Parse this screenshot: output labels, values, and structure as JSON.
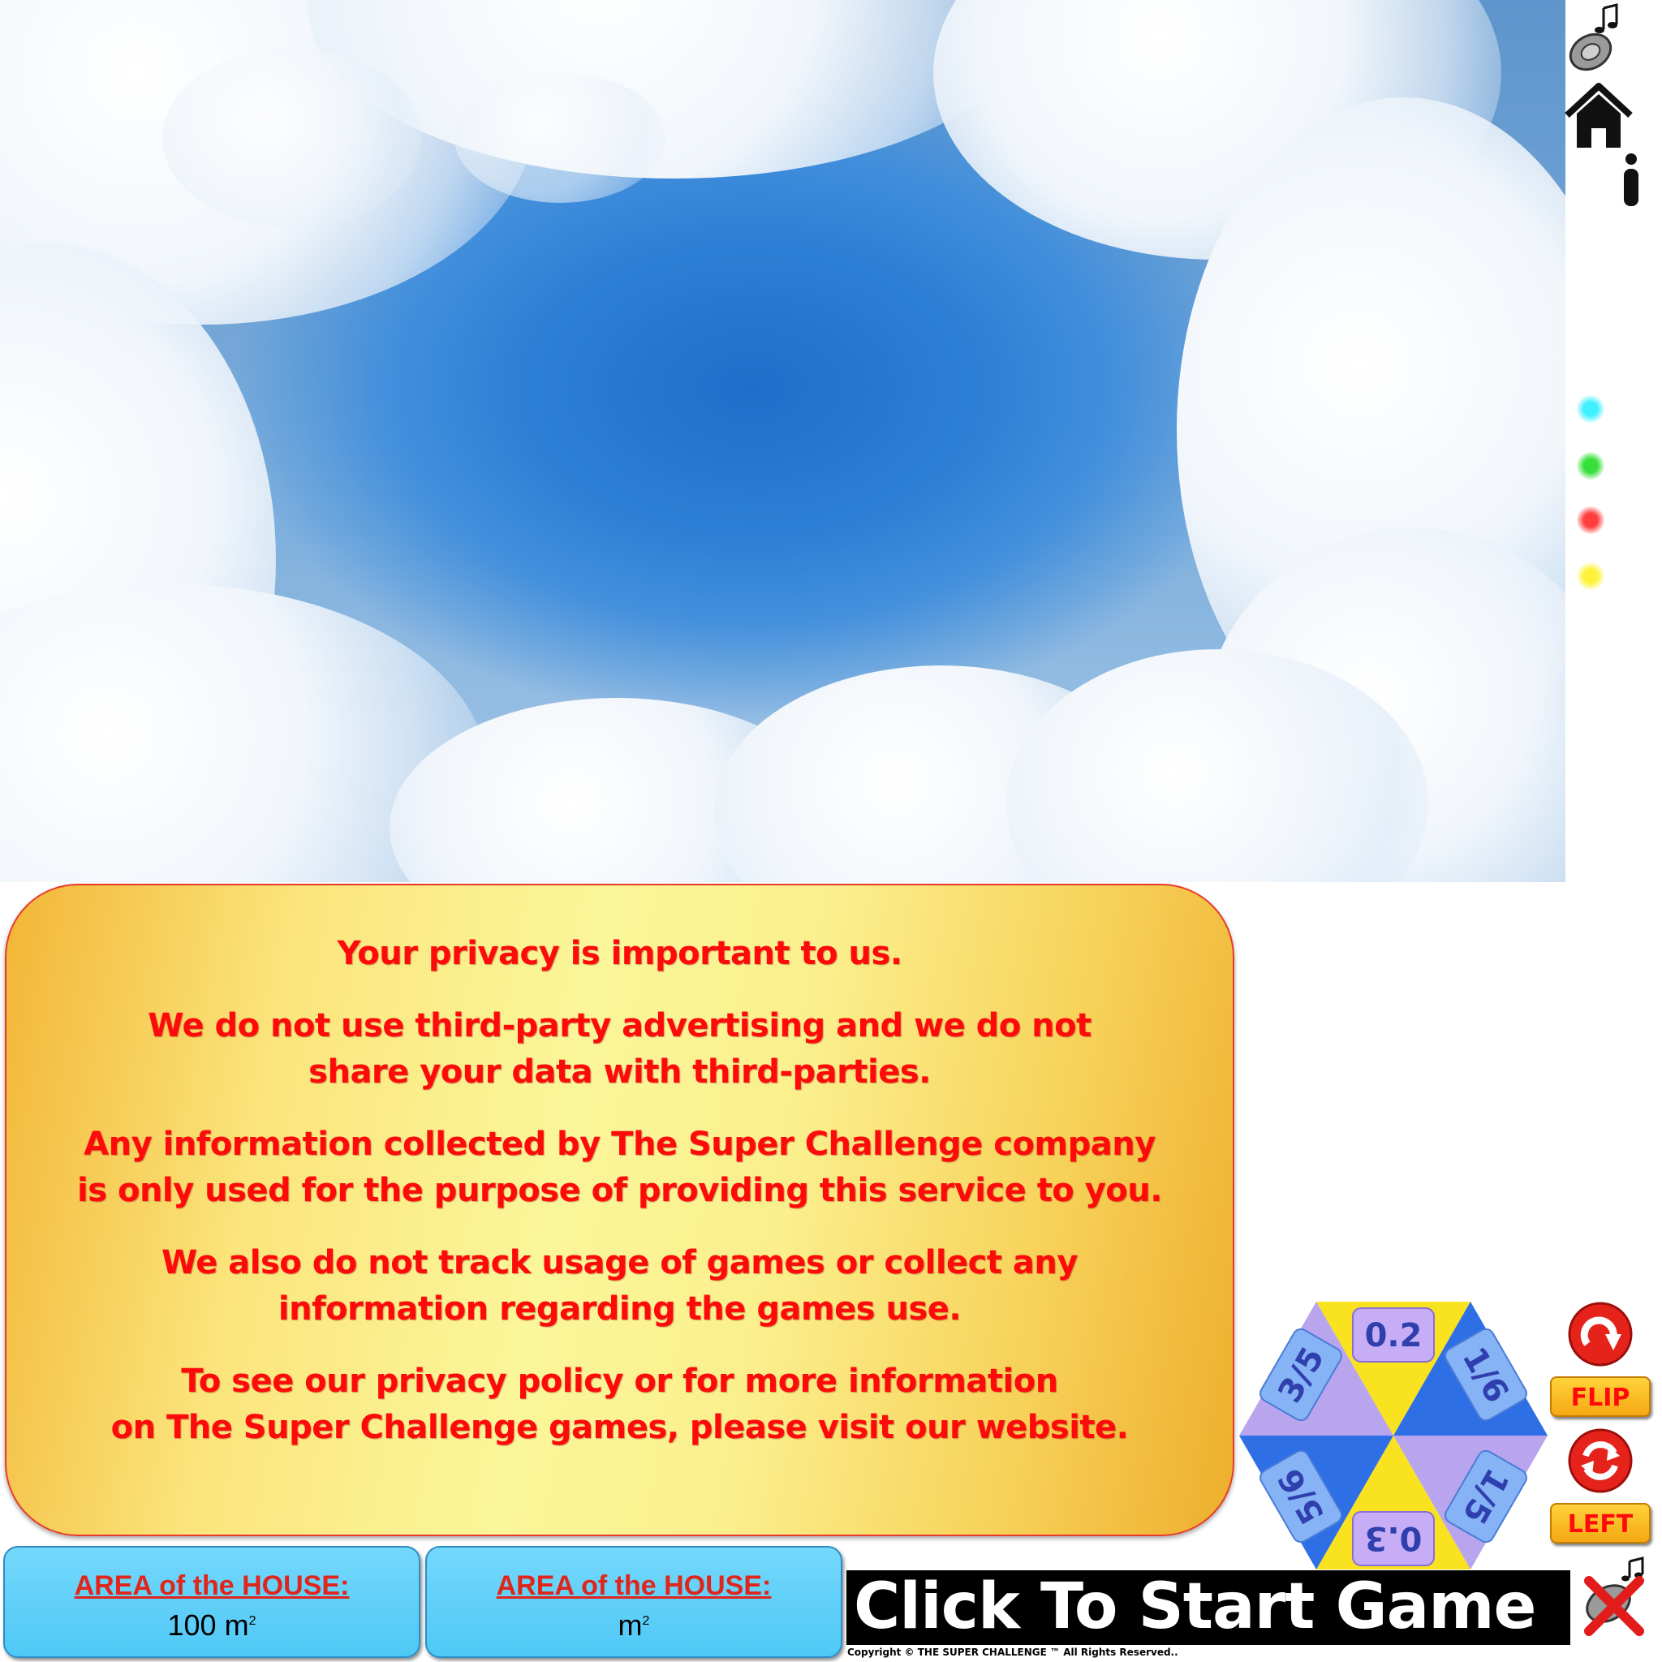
{
  "privacy_panel": {
    "paragraphs": [
      "Your privacy is important to us.",
      "We do not use third-party advertising and we do not\nshare your data with third-parties.",
      "Any information collected by The Super Challenge company\nis only used for the purpose of providing this service to you.",
      "We also do not track usage of games or collect any\ninformation regarding the games use.",
      "To see our privacy policy or for more information\non The Super Challenge games, please visit our website."
    ]
  },
  "area_boxes": [
    {
      "label": "AREA of the HOUSE:",
      "value": "100",
      "unit": "m",
      "unit_power": "2"
    },
    {
      "label": "AREA of the HOUSE:",
      "value": "",
      "unit": "m",
      "unit_power": "2"
    }
  ],
  "start_button": {
    "label": "Click To Start Game"
  },
  "copyright": "Copyright © THE SUPER CHALLENGE ™ All Rights Reserved..",
  "spinner_tiles": {
    "top": "0.2",
    "upper_right": "1/6",
    "lower_right": "1/5",
    "bottom": "0.3",
    "lower_left": "5/6",
    "upper_left": "3/5"
  },
  "controls": {
    "flip_label": "FLIP",
    "left_label": "LEFT"
  },
  "status_dots": [
    "#3ff0ff",
    "#36e03a",
    "#ff3f3f",
    "#fff23a"
  ],
  "icons": [
    "music-speaker-icon",
    "home-icon",
    "info-icon",
    "rotate-flip-icon",
    "rotate-left-icon",
    "sound-off-icon"
  ]
}
